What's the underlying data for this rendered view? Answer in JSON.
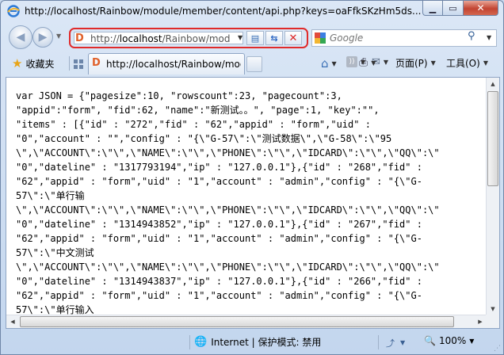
{
  "window": {
    "title": "http://localhost/Rainbow/module/member/content/api.php?keys=oaFfkSKzHm5ds..."
  },
  "address_bar": {
    "url_prefix": "http://",
    "url_host": "localhost",
    "url_path": "/Rainbow/mod"
  },
  "search": {
    "placeholder": "Google"
  },
  "favorites": {
    "label": "收藏夹"
  },
  "tab": {
    "title": "http://localhost/Rainbow/mod..."
  },
  "commands": {
    "page_label": "页面(P)",
    "tools_label": "工具(O)"
  },
  "content": {
    "lines": [
      "var JSON = {\"pagesize\":10, \"rowscount\":23, \"pagecount\":3,",
      "\"appid\":\"form\", \"fid\":62, \"name\":\"新测试。。\", \"page\":1, \"key\":\"\",",
      "\"items\" : [{\"id\" : \"272\",\"fid\" : \"62\",\"appid\" : \"form\",\"uid\" :",
      "\"0\",\"account\" : \"\",\"config\" : \"{\\\"G-57\\\":\\\"测试数据\\\",\\\"G-58\\\":\\\"95",
      "\\\",\\\"ACCOUNT\\\":\\\"\\\",\\\"NAME\\\":\\\"\\\",\\\"PHONE\\\":\\\"\\\",\\\"IDCARD\\\":\\\"\\\",\\\"QQ\\\":\\\"",
      "\"0\",\"dateline\" : \"1317793194\",\"ip\" : \"127.0.0.1\"},{\"id\" : \"268\",\"fid\" :",
      "\"62\",\"appid\" : \"form\",\"uid\" : \"1\",\"account\" : \"admin\",\"config\" : \"{\\\"G-",
      "57\\\":\\\"单行输",
      "\\\",\\\"ACCOUNT\\\":\\\"\\\",\\\"NAME\\\":\\\"\\\",\\\"PHONE\\\":\\\"\\\",\\\"IDCARD\\\":\\\"\\\",\\\"QQ\\\":\\\"",
      "\"0\",\"dateline\" : \"1314943852\",\"ip\" : \"127.0.0.1\"},{\"id\" : \"267\",\"fid\" :",
      "\"62\",\"appid\" : \"form\",\"uid\" : \"1\",\"account\" : \"admin\",\"config\" : \"{\\\"G-",
      "57\\\":\\\"中文测试",
      "\\\",\\\"ACCOUNT\\\":\\\"\\\",\\\"NAME\\\":\\\"\\\",\\\"PHONE\\\":\\\"\\\",\\\"IDCARD\\\":\\\"\\\",\\\"QQ\\\":\\\"",
      "\"0\",\"dateline\" : \"1314943837\",\"ip\" : \"127.0.0.1\"},{\"id\" : \"266\",\"fid\" :",
      "\"62\",\"appid\" : \"form\",\"uid\" : \"1\",\"account\" : \"admin\",\"config\" : \"{\\\"G-",
      "57\\\":\\\"单行输入"
    ]
  },
  "status": {
    "zone": "Internet | 保护模式: 禁用",
    "zoom": "100%"
  },
  "colors": {
    "address_highlight": "#e02b2b",
    "favicon": "#e0612b"
  }
}
